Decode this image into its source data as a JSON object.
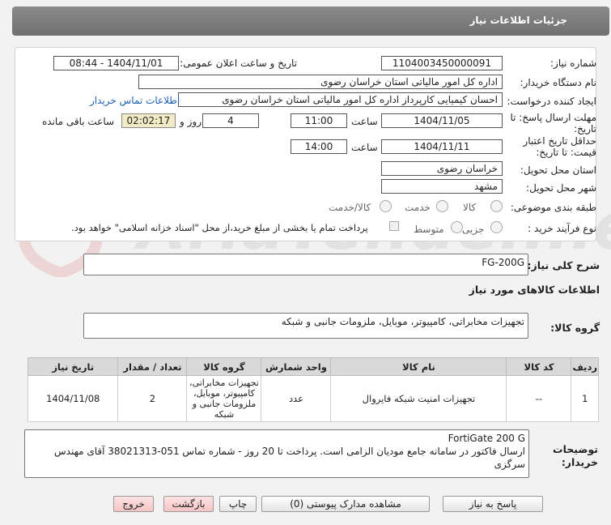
{
  "header": {
    "title": "جزئیات اطلاعات نیاز"
  },
  "fields": {
    "need_number_label": "شماره نیاز:",
    "need_number": "1104003450000091",
    "announce_label": "تاریخ و ساعت اعلان عمومی:",
    "announce_value": "1404/11/01 - 08:44",
    "buyer_org_label": "نام دستگاه خریدار:",
    "buyer_org": "اداره کل امور مالیاتی استان خراسان رضوی",
    "creator_label": "ایجاد کننده درخواست:",
    "creator": "احسان کیمیایی کارپرداز اداره کل امور مالیاتی استان خراسان رضوی",
    "buyer_contact_link": "اطلاعات تماس خریدار",
    "deadline_label_1": "مهلت ارسال پاسخ: تا",
    "deadline_label_2": "تاریخ:",
    "deadline_date": "1404/11/05",
    "time_label": "ساعت",
    "deadline_time": "11:00",
    "days_value": "4",
    "days_label": "روز و",
    "remaining_time": "02:02:17",
    "remaining_label": "ساعت باقی مانده",
    "validity_label_1": "حداقل تاریخ اعتبار",
    "validity_label_2": "قیمت: تا تاریخ:",
    "validity_date": "1404/11/11",
    "validity_time_label": "ساعت",
    "validity_time": "14:00",
    "province_label": "استان محل تحویل:",
    "province": "خراسان رضوی",
    "city_label": "شهر محل تحویل:",
    "city": "مشهد",
    "category_label": "طبقه بندی موضوعی:",
    "category_options": [
      "کالا",
      "خدمت",
      "کالا/خدمت"
    ],
    "process_label": "نوع فرآیند خرید :",
    "process_options": [
      "جزیی",
      "متوسط"
    ],
    "payment_note": "پرداخت تمام یا بخشی از مبلغ خرید،از محل \"اسناد خزانه اسلامی\" خواهد بود."
  },
  "summary": {
    "label": "شرح کلی نیاز:",
    "value": "FG-200G"
  },
  "goods_section": {
    "title": "اطلاعات کالاهای مورد نیاز",
    "group_label": "گروه کالا:",
    "group_value": "تجهیزات مخابراتی، کامپیوتر، موبایل، ملزومات جانبی و شبکه"
  },
  "table": {
    "headers": [
      "ردیف",
      "کد کالا",
      "نام کالا",
      "واحد شمارش",
      "گروه کالا",
      "تعداد / مقدار",
      "تاریخ نیاز"
    ],
    "rows": [
      [
        "1",
        "--",
        "تجهیزات امنیت شبکه فایروال",
        "عدد",
        "تجهیزات مخابراتی، کامپیوتر، موبایل، ملزومات جانبی و شبکه",
        "2",
        "1404/11/08"
      ]
    ]
  },
  "buyer_notes": {
    "label_1": "توضیحات",
    "label_2": "خریدار:",
    "line1": "FortiGate 200 G",
    "line2": "ارسال فاکتور در سامانه جامع مودیان الزامی است. پرداخت تا 20 روز - شماره تماس 051-38021313 آقای مهندس سرگزی"
  },
  "buttons": {
    "reply": "پاسخ به نیاز",
    "attachments": "مشاهده مدارک پیوستی (0)",
    "print": "چاپ",
    "back": "بازگشت",
    "exit": "خروج"
  },
  "colors": {
    "header_bg": "#7b7b7b",
    "timer_bg": "#f1ebc5",
    "link": "#1a5fb4",
    "back_button": "#f7c4c4",
    "watermark_red": "#e2b7b7"
  }
}
